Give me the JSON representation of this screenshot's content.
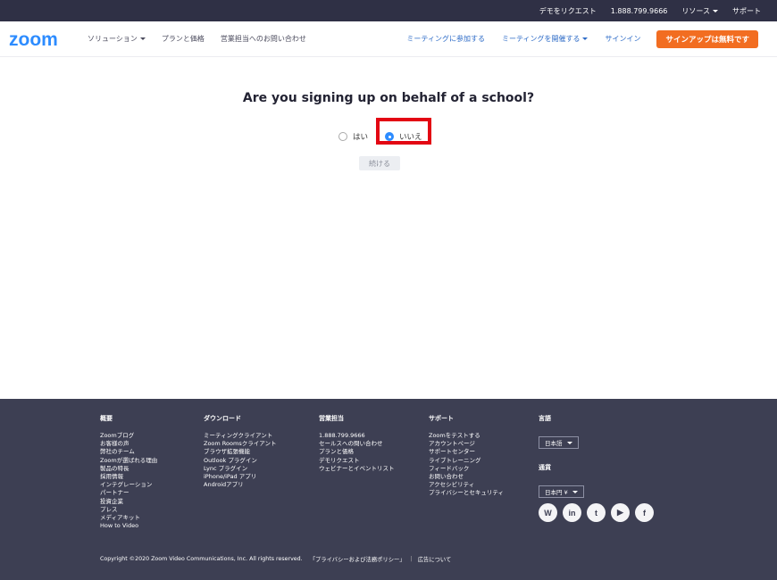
{
  "topbar": {
    "links": [
      "デモをリクエスト",
      "1.888.799.9666"
    ],
    "resources_label": "リソース",
    "support_label": "サポート"
  },
  "header": {
    "logo_text": "zoom",
    "nav_left": {
      "solutions_label": "ソリューション",
      "plans_label": "プランと価格",
      "sales_label": "営業担当へのお問い合わせ"
    },
    "nav_right": {
      "join_label": "ミーティングに参加する",
      "host_label": "ミーティングを開催する",
      "signin_label": "サインイン"
    },
    "signup_label": "サインアップは無料です",
    "brand_color": "#2d8cff",
    "signup_color": "#f26d21"
  },
  "main": {
    "question": "Are you signing up on behalf of a school?",
    "options": [
      {
        "label": "はい",
        "checked": false
      },
      {
        "label": "いいえ",
        "checked": true
      }
    ],
    "continue_label": "続ける",
    "highlight_color": "#e30613"
  },
  "footer": {
    "columns": [
      {
        "heading": "概要",
        "links": [
          "Zoomブログ",
          "お客様の声",
          "弊社のチーム",
          "Zoomが選ばれる理由",
          "製品の特長",
          "採用情報",
          "インテグレーション",
          "パートナー",
          "投資企業",
          "プレス",
          "メディアキット",
          "How to Video"
        ]
      },
      {
        "heading": "ダウンロード",
        "links": [
          "ミーティングクライアント",
          "Zoom Roomsクライアント",
          "ブラウザ拡張機能",
          "Outlook プラグイン",
          "Lync プラグイン",
          "iPhone/iPad アプリ",
          "Androidアプリ"
        ]
      },
      {
        "heading": "営業担当",
        "links": [
          "1.888.799.9666",
          "セールスへの問い合わせ",
          "プランと価格",
          "デモリクエスト",
          "ウェビナーとイベントリスト"
        ]
      },
      {
        "heading": "サポート",
        "links": [
          "Zoomをテストする",
          "アカウントページ",
          "サポートセンター",
          "ライブトレーニング",
          "フィードバック",
          "お問い合わせ",
          "アクセシビリティ",
          "プライバシーとセキュリティ"
        ]
      }
    ],
    "language": {
      "heading": "言語",
      "value": "日本語"
    },
    "currency": {
      "heading": "通貨",
      "value": "日本円 ¥"
    },
    "socials": [
      {
        "icon": "wordpress-icon",
        "glyph": "W"
      },
      {
        "icon": "linkedin-icon",
        "glyph": "in"
      },
      {
        "icon": "twitter-icon",
        "glyph": "t"
      },
      {
        "icon": "youtube-icon",
        "glyph": "▶"
      },
      {
        "icon": "facebook-icon",
        "glyph": "f"
      }
    ],
    "copyright": "Copyright ©2020 Zoom Video Communications, Inc. All rights reserved.",
    "privacy_label": "「プライバシーおよび法務ポリシー」",
    "ads_label": "広告について"
  }
}
